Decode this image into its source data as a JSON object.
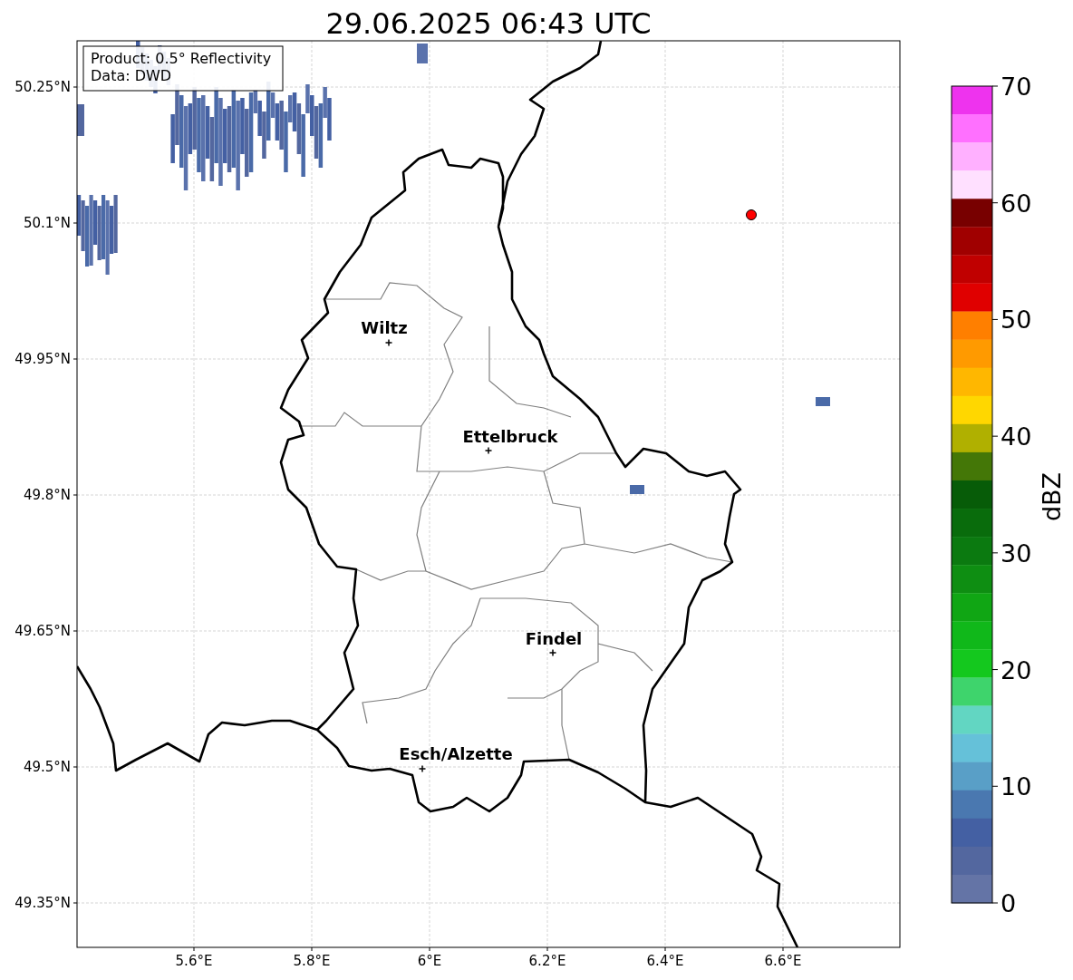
{
  "title": "29.06.2025 06:43 UTC",
  "map": {
    "x_tick_labels": [
      "5.6°E",
      "5.8°E",
      "6°E",
      "6.2°E",
      "6.4°E",
      "6.6°E"
    ],
    "y_tick_labels": [
      "50.25°N",
      "50.1°N",
      "49.95°N",
      "49.8°N",
      "49.65°N",
      "49.5°N",
      "49.35°N"
    ],
    "cities": [
      "Wiltz",
      "Ettelbruck",
      "Findel",
      "Esch/Alzette"
    ],
    "legend": [
      "Product: 0.5° Reflectivity",
      "Data: DWD"
    ]
  },
  "colorbar": {
    "label": "dBZ",
    "ticks": [
      "70",
      "60",
      "50",
      "40",
      "30",
      "20",
      "10",
      "0"
    ],
    "bands": [
      {
        "color": "#ee33ee"
      },
      {
        "color": "#ff70ff"
      },
      {
        "color": "#ffb0ff"
      },
      {
        "color": "#ffe0ff"
      },
      {
        "color": "#780000"
      },
      {
        "color": "#a00000"
      },
      {
        "color": "#c00000"
      },
      {
        "color": "#e00000"
      },
      {
        "color": "#ff7f00"
      },
      {
        "color": "#ff9a00"
      },
      {
        "color": "#ffb700"
      },
      {
        "color": "#ffd700"
      },
      {
        "color": "#b0b000"
      },
      {
        "color": "#447707"
      },
      {
        "color": "#075c08"
      },
      {
        "color": "#096c0c"
      },
      {
        "color": "#0b7a10"
      },
      {
        "color": "#0e8e12"
      },
      {
        "color": "#10a614"
      },
      {
        "color": "#10b81a"
      },
      {
        "color": "#14c81e"
      },
      {
        "color": "#3ed46c"
      },
      {
        "color": "#62d6c2"
      },
      {
        "color": "#65c1d9"
      },
      {
        "color": "#599fc7"
      },
      {
        "color": "#4a78b0"
      },
      {
        "color": "#4460a3"
      },
      {
        "color": "#53679f"
      },
      {
        "color": "#6474a6"
      }
    ]
  }
}
